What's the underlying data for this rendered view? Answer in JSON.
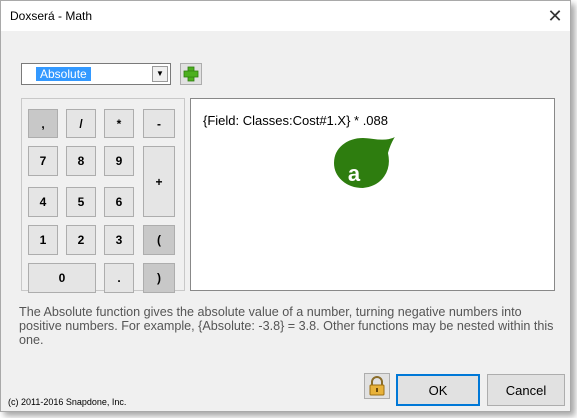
{
  "window": {
    "title": "Doxserá - Math",
    "close_glyph": "✕"
  },
  "function_select": {
    "selected": "Absolute",
    "arrow_glyph": "▼"
  },
  "add_button": {
    "icon": "green-plus-icon"
  },
  "keypad": {
    "keys": [
      ",",
      "/",
      "*",
      "-",
      "7",
      "8",
      "9",
      "+",
      "4",
      "5",
      "6",
      "1",
      "2",
      "3",
      "(",
      "0",
      ".",
      ")"
    ]
  },
  "formula": {
    "text": "{Field: Classes:Cost#1.X} * .088"
  },
  "callout": {
    "label": "a",
    "color": "#2e7d0f"
  },
  "description": "The Absolute function gives the absolute value of a number, turning negative numbers into positive numbers.  For example, {Absolute: -3.8} = 3.8.  Other functions may be nested within this one.",
  "footer": {
    "copyright": "(c) 2011-2016 Snapdone, Inc.",
    "lock_icon": "lock-icon",
    "ok_label": "OK",
    "cancel_label": "Cancel"
  }
}
